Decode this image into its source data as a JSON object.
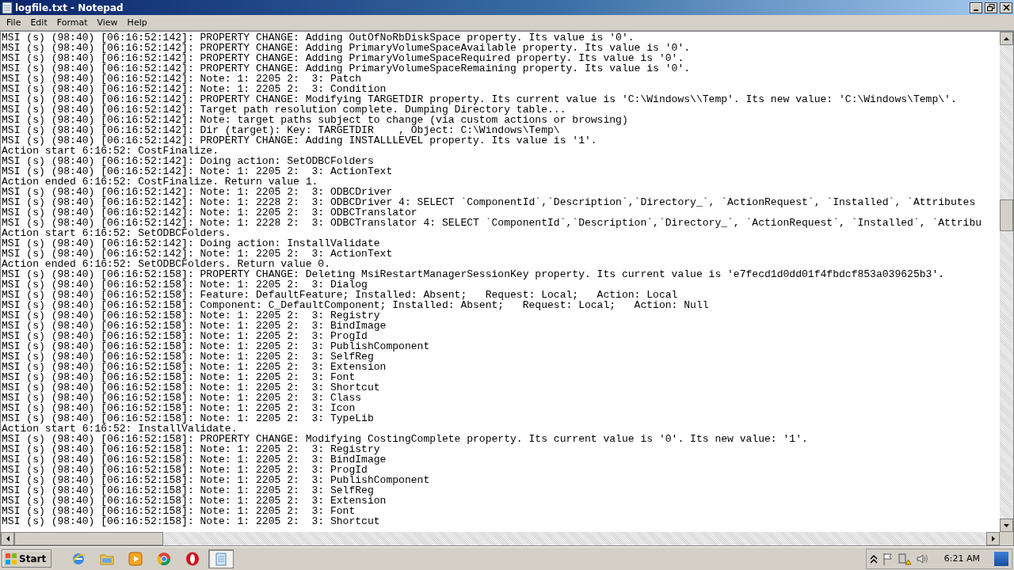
{
  "window": {
    "title": "logfile.txt - Notepad"
  },
  "menu": [
    {
      "label": "File"
    },
    {
      "label": "Edit"
    },
    {
      "label": "Format"
    },
    {
      "label": "View"
    },
    {
      "label": "Help"
    }
  ],
  "lines": [
    "MSI (s) (98:40) [06:16:52:142]: PROPERTY CHANGE: Adding OutOfNoRbDiskSpace property. Its value is '0'.",
    "MSI (s) (98:40) [06:16:52:142]: PROPERTY CHANGE: Adding PrimaryVolumeSpaceAvailable property. Its value is '0'.",
    "MSI (s) (98:40) [06:16:52:142]: PROPERTY CHANGE: Adding PrimaryVolumeSpaceRequired property. Its value is '0'.",
    "MSI (s) (98:40) [06:16:52:142]: PROPERTY CHANGE: Adding PrimaryVolumeSpaceRemaining property. Its value is '0'.",
    "MSI (s) (98:40) [06:16:52:142]: Note: 1: 2205 2:  3: Patch",
    "MSI (s) (98:40) [06:16:52:142]: Note: 1: 2205 2:  3: Condition",
    "MSI (s) (98:40) [06:16:52:142]: PROPERTY CHANGE: Modifying TARGETDIR property. Its current value is 'C:\\Windows\\\\Temp'. Its new value: 'C:\\Windows\\Temp\\'.",
    "MSI (s) (98:40) [06:16:52:142]: Target path resolution complete. Dumping Directory table...",
    "MSI (s) (98:40) [06:16:52:142]: Note: target paths subject to change (via custom actions or browsing)",
    "MSI (s) (98:40) [06:16:52:142]: Dir (target): Key: TARGETDIR    , Object: C:\\Windows\\Temp\\",
    "MSI (s) (98:40) [06:16:52:142]: PROPERTY CHANGE: Adding INSTALLLEVEL property. Its value is '1'.",
    "Action start 6:16:52: CostFinalize.",
    "MSI (s) (98:40) [06:16:52:142]: Doing action: SetODBCFolders",
    "MSI (s) (98:40) [06:16:52:142]: Note: 1: 2205 2:  3: ActionText",
    "Action ended 6:16:52: CostFinalize. Return value 1.",
    "MSI (s) (98:40) [06:16:52:142]: Note: 1: 2205 2:  3: ODBCDriver",
    "MSI (s) (98:40) [06:16:52:142]: Note: 1: 2228 2:  3: ODBCDriver 4: SELECT `ComponentId`,`Description`,`Directory_`, `ActionRequest`, `Installed`, `Attributes",
    "MSI (s) (98:40) [06:16:52:142]: Note: 1: 2205 2:  3: ODBCTranslator",
    "MSI (s) (98:40) [06:16:52:142]: Note: 1: 2228 2:  3: ODBCTranslator 4: SELECT `ComponentId`,`Description`,`Directory_`, `ActionRequest`, `Installed`, `Attribu",
    "Action start 6:16:52: SetODBCFolders.",
    "MSI (s) (98:40) [06:16:52:142]: Doing action: InstallValidate",
    "MSI (s) (98:40) [06:16:52:142]: Note: 1: 2205 2:  3: ActionText",
    "Action ended 6:16:52: SetODBCFolders. Return value 0.",
    "MSI (s) (98:40) [06:16:52:158]: PROPERTY CHANGE: Deleting MsiRestartManagerSessionKey property. Its current value is 'e7fecd1d0dd01f4fbdcf853a039625b3'.",
    "MSI (s) (98:40) [06:16:52:158]: Note: 1: 2205 2:  3: Dialog",
    "MSI (s) (98:40) [06:16:52:158]: Feature: DefaultFeature; Installed: Absent;   Request: Local;   Action: Local",
    "MSI (s) (98:40) [06:16:52:158]: Component: C_DefaultComponent; Installed: Absent;   Request: Local;   Action: Null",
    "MSI (s) (98:40) [06:16:52:158]: Note: 1: 2205 2:  3: Registry",
    "MSI (s) (98:40) [06:16:52:158]: Note: 1: 2205 2:  3: BindImage",
    "MSI (s) (98:40) [06:16:52:158]: Note: 1: 2205 2:  3: ProgId",
    "MSI (s) (98:40) [06:16:52:158]: Note: 1: 2205 2:  3: PublishComponent",
    "MSI (s) (98:40) [06:16:52:158]: Note: 1: 2205 2:  3: SelfReg",
    "MSI (s) (98:40) [06:16:52:158]: Note: 1: 2205 2:  3: Extension",
    "MSI (s) (98:40) [06:16:52:158]: Note: 1: 2205 2:  3: Font",
    "MSI (s) (98:40) [06:16:52:158]: Note: 1: 2205 2:  3: Shortcut",
    "MSI (s) (98:40) [06:16:52:158]: Note: 1: 2205 2:  3: Class",
    "MSI (s) (98:40) [06:16:52:158]: Note: 1: 2205 2:  3: Icon",
    "MSI (s) (98:40) [06:16:52:158]: Note: 1: 2205 2:  3: TypeLib",
    "Action start 6:16:52: InstallValidate.",
    "MSI (s) (98:40) [06:16:52:158]: PROPERTY CHANGE: Modifying CostingComplete property. Its current value is '0'. Its new value: '1'.",
    "MSI (s) (98:40) [06:16:52:158]: Note: 1: 2205 2:  3: Registry",
    "MSI (s) (98:40) [06:16:52:158]: Note: 1: 2205 2:  3: BindImage",
    "MSI (s) (98:40) [06:16:52:158]: Note: 1: 2205 2:  3: ProgId",
    "MSI (s) (98:40) [06:16:52:158]: Note: 1: 2205 2:  3: PublishComponent",
    "MSI (s) (98:40) [06:16:52:158]: Note: 1: 2205 2:  3: SelfReg",
    "MSI (s) (98:40) [06:16:52:158]: Note: 1: 2205 2:  3: Extension",
    "MSI (s) (98:40) [06:16:52:158]: Note: 1: 2205 2:  3: Font",
    "MSI (s) (98:40) [06:16:52:158]: Note: 1: 2205 2:  3: Shortcut"
  ],
  "taskbar": {
    "start": "Start",
    "apps": [
      {
        "kind": "ie",
        "selected": false
      },
      {
        "kind": "explorer",
        "selected": false
      },
      {
        "kind": "media",
        "selected": false
      },
      {
        "kind": "chrome",
        "selected": false
      },
      {
        "kind": "opera",
        "selected": false
      },
      {
        "kind": "notepad",
        "selected": true
      }
    ],
    "tray": [
      {
        "kind": "chevron"
      },
      {
        "kind": "flag"
      },
      {
        "kind": "network"
      },
      {
        "kind": "speaker"
      }
    ],
    "clock": "6:21 AM"
  }
}
